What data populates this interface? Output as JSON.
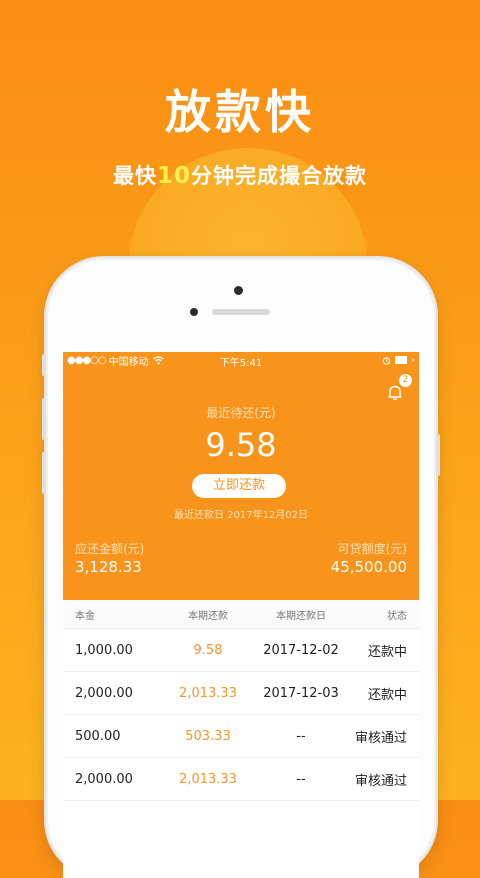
{
  "promo": {
    "title": "放款快",
    "subtitle_before": "最快",
    "subtitle_highlight": "10",
    "subtitle_after": "分钟完成撮合放款"
  },
  "status_bar": {
    "signal": "●●●○○",
    "carrier": "中国移动",
    "time": "下午5:41"
  },
  "notification": {
    "badge_count": "2"
  },
  "hero": {
    "label": "最近待还(元)",
    "amount": "9.58",
    "repay_button": "立即还款",
    "due_date": "最近还款日 2017年12月02日",
    "left_label": "应还金额(元)",
    "left_value": "3,128.33",
    "right_label": "可贷额度(元)",
    "right_value": "45,500.00"
  },
  "table": {
    "headers": [
      "本金",
      "本期还款",
      "本期还款日",
      "状态"
    ],
    "rows": [
      [
        "1,000.00",
        "9.58",
        "2017-12-02",
        "还款中"
      ],
      [
        "2,000.00",
        "2,013.33",
        "2017-12-03",
        "还款中"
      ],
      [
        "500.00",
        "503.33",
        "--",
        "审核通过"
      ],
      [
        "2,000.00",
        "2,013.33",
        "--",
        "审核通过"
      ]
    ]
  },
  "colors": {
    "brand_orange": "#f8941c",
    "highlight_yellow": "#fff14a"
  }
}
